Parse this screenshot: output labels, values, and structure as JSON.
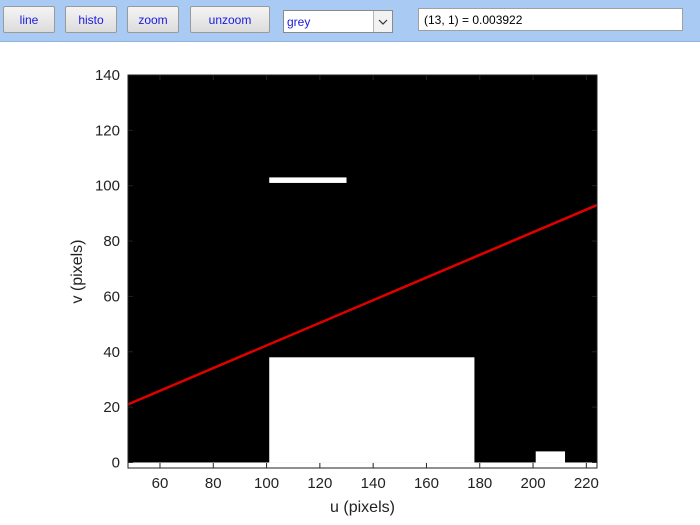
{
  "toolbar": {
    "buttons": [
      {
        "label": "line"
      },
      {
        "label": "histo"
      },
      {
        "label": "zoom"
      },
      {
        "label": "unzoom"
      }
    ],
    "colormap_select": {
      "value": "grey"
    },
    "pixel_readout": "(13, 1) = 0.003922",
    "background_color": "#a9cbf3",
    "button_text_color": "#1a1adf"
  },
  "image_plot": {
    "xlabel": "u (pixels)",
    "ylabel": "v (pixels)",
    "xlim": [
      48,
      224
    ],
    "ylim": [
      140,
      -2
    ],
    "xticks": [
      60,
      80,
      100,
      120,
      140,
      160,
      180,
      200,
      220
    ],
    "yticks": [
      0,
      20,
      40,
      60,
      80,
      100,
      120,
      140
    ],
    "image_background": "#000000",
    "white_regions": [
      {
        "u0": 48,
        "u1": 224,
        "v0": -2,
        "v1": 0
      },
      {
        "u0": 101,
        "u1": 178,
        "v0": 0,
        "v1": 38
      },
      {
        "u0": 201,
        "u1": 212,
        "v0": 0,
        "v1": 4
      },
      {
        "u0": 101,
        "u1": 130,
        "v0": 101,
        "v1": 103
      }
    ],
    "overlay_line": {
      "u0": 48,
      "v0": 21,
      "u1": 224,
      "v1": 93,
      "color": "#e00000"
    }
  }
}
